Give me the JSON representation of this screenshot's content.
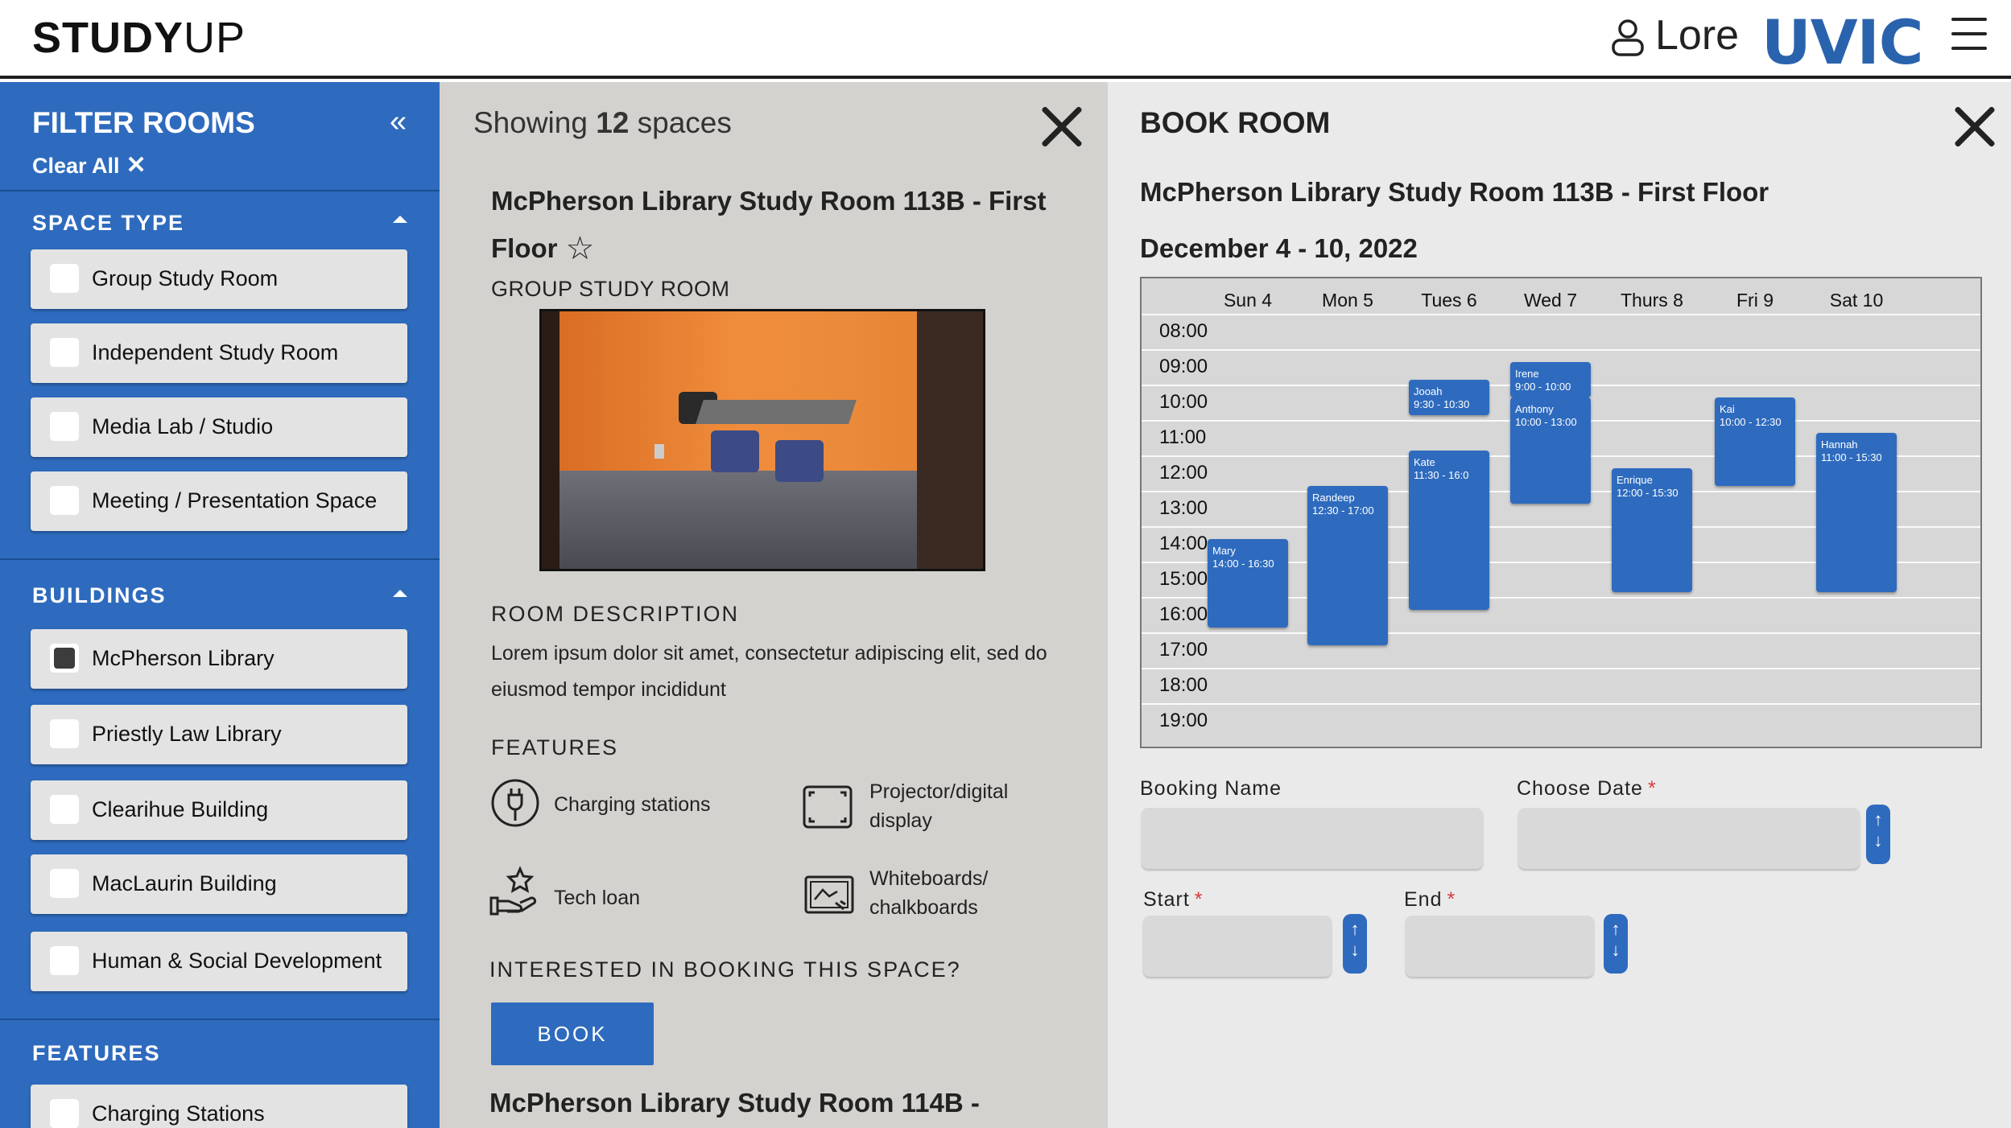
{
  "header": {
    "logo_bold": "STUDY",
    "logo_light": "UP",
    "user_name": "Lore",
    "brand": "UVIC"
  },
  "sidebar": {
    "title": "FILTER ROOMS",
    "collapse_glyph": "«",
    "clear_all": "Clear All",
    "clear_glyph": "✕",
    "sections": [
      {
        "title": "SPACE TYPE",
        "items": [
          {
            "label": "Group Study Room",
            "checked": false
          },
          {
            "label": "Independent Study Room",
            "checked": false
          },
          {
            "label": "Media Lab / Studio",
            "checked": false
          },
          {
            "label": "Meeting / Presentation Space",
            "checked": false
          }
        ]
      },
      {
        "title": "BUILDINGS",
        "items": [
          {
            "label": "McPherson Library",
            "checked": true
          },
          {
            "label": "Priestly Law Library",
            "checked": false
          },
          {
            "label": "Clearihue Building",
            "checked": false
          },
          {
            "label": "MacLaurin Building",
            "checked": false
          },
          {
            "label": "Human & Social Development",
            "checked": false
          }
        ]
      },
      {
        "title": "FEATURES",
        "items": [
          {
            "label": "Charging Stations",
            "checked": false
          }
        ]
      }
    ]
  },
  "results": {
    "showing_prefix": "Showing",
    "count": "12",
    "showing_suffix": "spaces",
    "room_title": "McPherson Library Study Room 113B - First Floor",
    "star_glyph": "☆",
    "room_type": "GROUP STUDY ROOM",
    "description_title": "ROOM DESCRIPTION",
    "description": "Lorem ipsum dolor sit amet, consectetur adipiscing elit, sed do eiusmod tempor incididunt",
    "features_title": "FEATURES",
    "features": [
      {
        "label": "Charging stations",
        "icon": "charging-icon"
      },
      {
        "label": "Projector/digital display",
        "icon": "projector-icon"
      },
      {
        "label": "Tech loan",
        "icon": "tech-loan-icon"
      },
      {
        "label": "Whiteboards/ chalkboards",
        "icon": "whiteboard-icon"
      }
    ],
    "book_question": "INTERESTED IN BOOKING THIS SPACE?",
    "book_button": "BOOK",
    "next_room_title": "McPherson Library Study Room 114B -"
  },
  "booking": {
    "title": "BOOK ROOM",
    "room": "McPherson Library Study Room 113B - First Floor",
    "date_range": "December 4 - 10, 2022",
    "days": [
      "Sun 4",
      "Mon 5",
      "Tues 6",
      "Wed 7",
      "Thurs 8",
      "Fri 9",
      "Sat 10"
    ],
    "times": [
      "08:00",
      "09:00",
      "10:00",
      "11:00",
      "12:00",
      "13:00",
      "14:00",
      "15:00",
      "16:00",
      "17:00",
      "18:00",
      "19:00"
    ],
    "events": [
      {
        "name": "Mary",
        "time": "14:00 - 16:30",
        "day": 0,
        "start": 14.0,
        "end": 16.5
      },
      {
        "name": "Randeep",
        "time": "12:30 - 17:00",
        "day": 1,
        "start": 12.5,
        "end": 17.0
      },
      {
        "name": "Jooah",
        "time": "9:30 - 10:30",
        "day": 2,
        "start": 9.5,
        "end": 10.5
      },
      {
        "name": "Kate",
        "time": "11:30 - 16:0",
        "day": 2,
        "start": 11.5,
        "end": 16.0
      },
      {
        "name": "Irene",
        "time": "9:00 - 10:00",
        "day": 3,
        "start": 9.0,
        "end": 10.0
      },
      {
        "name": "Anthony",
        "time": "10:00 - 13:00",
        "day": 3,
        "start": 10.0,
        "end": 13.0
      },
      {
        "name": "Enrique",
        "time": "12:00 - 15:30",
        "day": 4,
        "start": 12.0,
        "end": 15.5
      },
      {
        "name": "Kai",
        "time": "10:00 - 12:30",
        "day": 5,
        "start": 10.0,
        "end": 12.5
      },
      {
        "name": "Hannah",
        "time": "11:00 - 15:30",
        "day": 6,
        "start": 11.0,
        "end": 15.5
      }
    ],
    "form": {
      "booking_name_label": "Booking Name",
      "choose_date_label": "Choose Date",
      "start_label": "Start",
      "end_label": "End",
      "required_mark": "*",
      "booking_name_value": "",
      "choose_date_value": "",
      "start_value": "",
      "end_value": ""
    }
  }
}
